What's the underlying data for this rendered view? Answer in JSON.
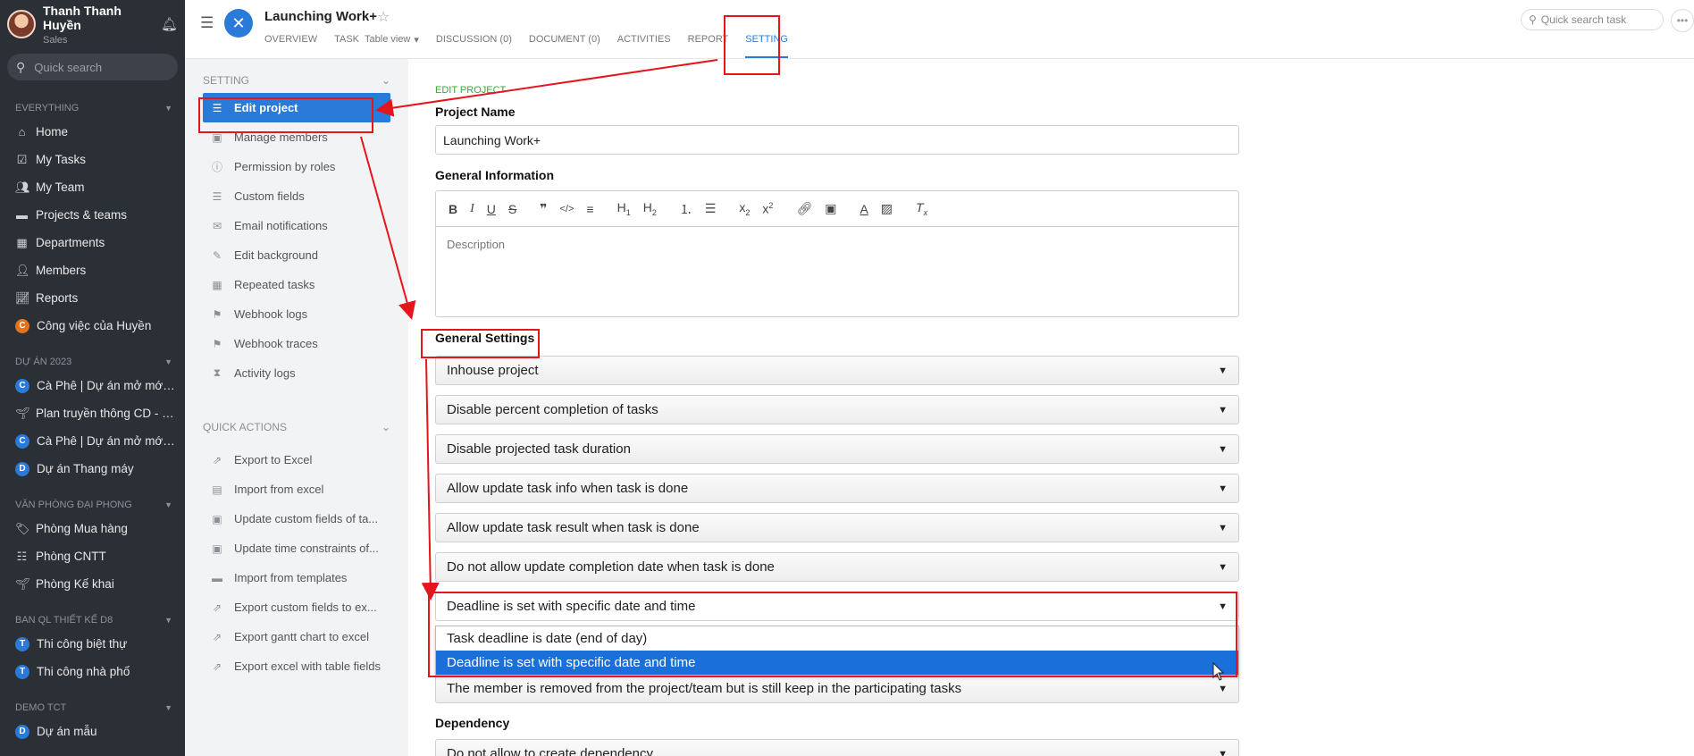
{
  "sidebar": {
    "user_name": "Thanh Thanh Huyền",
    "user_role": "Sales",
    "search_placeholder": "Quick search",
    "groups": [
      {
        "title": "Everything",
        "items": [
          {
            "label": "Home",
            "icon": "home-icon"
          },
          {
            "label": "My Tasks",
            "icon": "check-square-icon"
          },
          {
            "label": "My Team",
            "icon": "team-icon"
          },
          {
            "label": "Projects & teams",
            "icon": "folder-icon"
          },
          {
            "label": "Departments",
            "icon": "building-icon"
          },
          {
            "label": "Members",
            "icon": "members-icon"
          },
          {
            "label": "Reports",
            "icon": "chart-icon"
          },
          {
            "label": "Công việc của Huyền",
            "letter": "C",
            "color": "#e5721b"
          }
        ]
      },
      {
        "title": "Dự án 2023",
        "items": [
          {
            "label": "Cà Phê | Dự án mở mới c...",
            "letter": "C",
            "color": "#2a7bd9"
          },
          {
            "label": "Plan truyền thông CD - M...",
            "icon": "plant-icon"
          },
          {
            "label": "Cà Phê | Dự án mở mới V...",
            "letter": "C",
            "color": "#2a7bd9"
          },
          {
            "label": "Dự án Thang máy",
            "letter": "D",
            "color": "#2a7bd9"
          }
        ]
      },
      {
        "title": "Văn phòng Đại Phong",
        "items": [
          {
            "label": "Phòng Mua hàng",
            "icon": "tag-icon"
          },
          {
            "label": "Phòng CNTT",
            "icon": "org-chart-icon"
          },
          {
            "label": "Phòng Kế khai",
            "icon": "plant-icon"
          }
        ]
      },
      {
        "title": "Ban QL Thiết kế D8",
        "items": [
          {
            "label": "Thi công biệt thự",
            "letter": "T",
            "color": "#2a7bd9"
          },
          {
            "label": "Thi công nhà phố",
            "letter": "T",
            "color": "#2a7bd9"
          }
        ]
      },
      {
        "title": "Demo TCT",
        "items": [
          {
            "label": "Dự án mẫu",
            "letter": "D",
            "color": "#2a7bd9"
          }
        ]
      }
    ]
  },
  "settings_panel": {
    "title": "Setting",
    "items": [
      {
        "label": "Edit project",
        "icon": "list-icon",
        "active": true
      },
      {
        "label": "Manage members",
        "icon": "person-badge-icon"
      },
      {
        "label": "Permission by roles",
        "icon": "info-circle-icon"
      },
      {
        "label": "Custom fields",
        "icon": "database-icon"
      },
      {
        "label": "Email notifications",
        "icon": "envelope-icon"
      },
      {
        "label": "Edit background",
        "icon": "pencil-square-icon"
      },
      {
        "label": "Repeated tasks",
        "icon": "calendar-icon"
      },
      {
        "label": "Webhook logs",
        "icon": "flag-icon"
      },
      {
        "label": "Webhook traces",
        "icon": "flag-icon"
      },
      {
        "label": "Activity logs",
        "icon": "hourglass-icon"
      }
    ],
    "quick_actions_title": "Quick actions",
    "quick_actions": [
      {
        "label": "Export to Excel",
        "icon": "export-icon"
      },
      {
        "label": "Import from excel",
        "icon": "excel-file-icon"
      },
      {
        "label": "Update custom fields of ta...",
        "icon": "box-icon"
      },
      {
        "label": "Update time constraints of...",
        "icon": "box-icon"
      },
      {
        "label": "Import from templates",
        "icon": "folder-icon"
      },
      {
        "label": "Export custom fields to ex...",
        "icon": "export-icon"
      },
      {
        "label": "Export gantt chart to excel",
        "icon": "export-icon"
      },
      {
        "label": "Export excel with table fields",
        "icon": "export-icon"
      }
    ]
  },
  "header": {
    "project_title": "Launching Work+",
    "tabs": [
      {
        "label": "Overview"
      },
      {
        "label": "Task",
        "sub": "Table view"
      },
      {
        "label": "Discussion (0)"
      },
      {
        "label": "Document (0)"
      },
      {
        "label": "Activities"
      },
      {
        "label": "Report"
      },
      {
        "label": "Setting",
        "active": true
      }
    ],
    "search_placeholder": "Quick search task"
  },
  "form": {
    "section_tag": "Edit project",
    "project_name_label": "Project Name",
    "project_name_value": "Launching Work+",
    "general_info_label": "General Information",
    "description_placeholder": "Description",
    "general_settings_label": "General Settings",
    "selects": [
      "Inhouse project",
      "Disable percent completion of tasks",
      "Disable projected task duration",
      "Allow update task info when task is done",
      "Allow update task result when task is done",
      "Do not allow update completion date when task is done",
      "Deadline is set with specific date and time",
      "The member is removed from the project/team but is still keep in the participating tasks"
    ],
    "dropdown_options": [
      "Task deadline is date (end of day)",
      "Deadline is set with specific date and time"
    ],
    "dependency_label": "Dependency",
    "dependency_value": "Do not allow to create dependency"
  },
  "colors": {
    "sidebar_bg": "#2b2f36",
    "accent": "#2a7bd9",
    "annotation": "#e5151c",
    "section_tag": "#3aa53a"
  }
}
